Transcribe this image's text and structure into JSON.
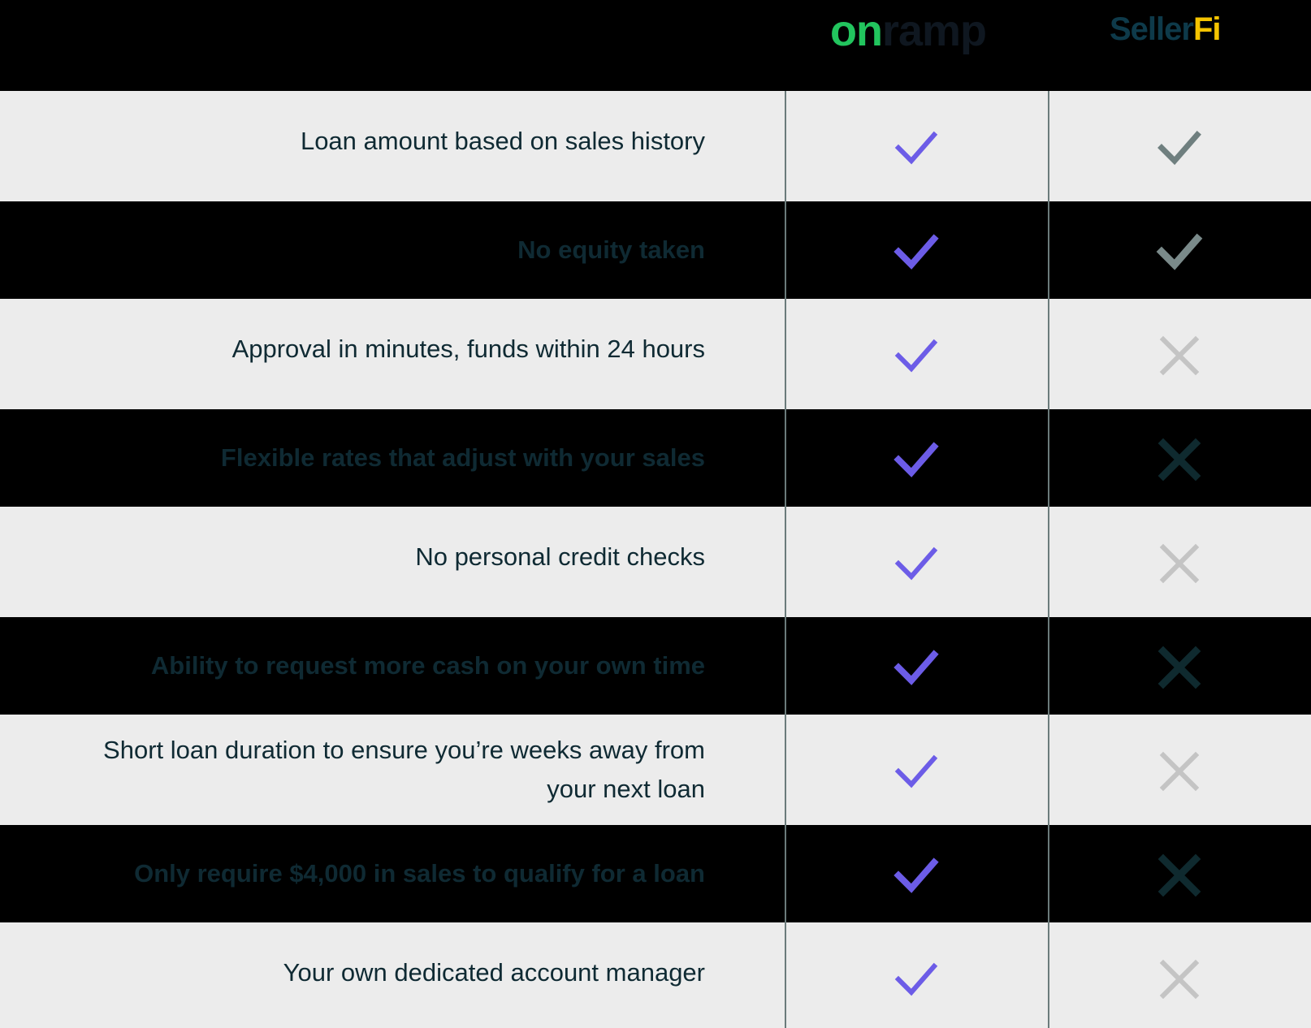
{
  "header": {
    "brand_a": {
      "part1": "on",
      "part2": "ramp"
    },
    "brand_b": {
      "part1": "Seller",
      "part2": "Fi"
    }
  },
  "colors": {
    "check_onramp": "#6c5ce7",
    "check_sellerfi_light": "#6f7f7f",
    "x_light": "#c4c4c4",
    "x_dark": "#0f2a2f",
    "row_light": "#ececec",
    "row_dark": "#000000",
    "label_text": "#0f2a33"
  },
  "rows": [
    {
      "label": "Loan amount based on sales history",
      "onramp": "check",
      "sellerfi": "check"
    },
    {
      "label": "No equity taken",
      "onramp": "check",
      "sellerfi": "check"
    },
    {
      "label": "Approval in minutes, funds within 24 hours",
      "onramp": "check",
      "sellerfi": "x"
    },
    {
      "label": "Flexible rates that adjust with your sales",
      "onramp": "check",
      "sellerfi": "x"
    },
    {
      "label": "No personal credit checks",
      "onramp": "check",
      "sellerfi": "x"
    },
    {
      "label": "Ability to request more cash on your own time",
      "onramp": "check",
      "sellerfi": "x"
    },
    {
      "label": "Short loan duration to ensure you’re weeks away from your next loan",
      "onramp": "check",
      "sellerfi": "x"
    },
    {
      "label": "Only require $4,000 in sales to qualify for a loan",
      "onramp": "check",
      "sellerfi": "x"
    },
    {
      "label": "Your own dedicated account manager",
      "onramp": "check",
      "sellerfi": "x"
    }
  ]
}
